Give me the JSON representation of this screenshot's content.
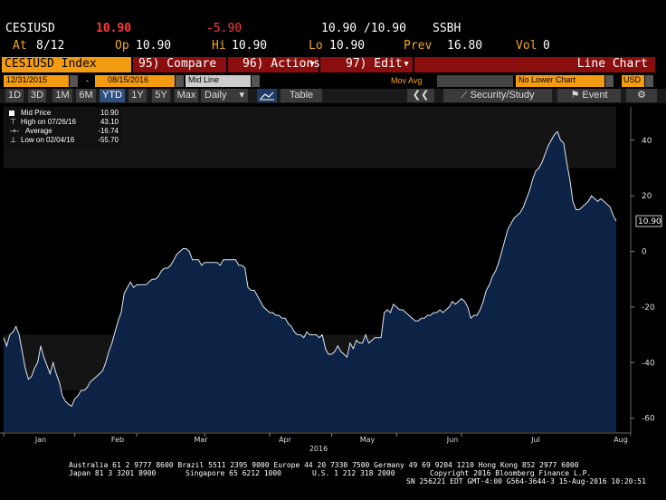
{
  "header": {
    "ticker": "CESIUSD",
    "last": "10.90",
    "change": "-5.90",
    "bidask": "10.90 /10.90",
    "source": "SSBH",
    "at_label": "At",
    "at_value": "8/12",
    "op_label": "Op",
    "op_value": "10.90",
    "hi_label": "Hi",
    "hi_value": "10.90",
    "lo_label": "Lo",
    "lo_value": "10.90",
    "prev_label": "Prev",
    "prev_value": "16.80",
    "vol_label": "Vol",
    "vol_value": "0"
  },
  "menubar": {
    "security_label": "CESIUSD Index",
    "compare": "95) Compare",
    "actions": "96) Actions",
    "edit": "97) Edit",
    "chart_type": "Line Chart"
  },
  "toolbar": {
    "start_date": "12/31/2015",
    "dash": "-",
    "end_date": "08/15/2016",
    "mid_line": "Mid Line",
    "mov_avg": "Mov Avg",
    "lower_chart": "No Lower Chart",
    "currency": "USD"
  },
  "periods": {
    "items": [
      "1D",
      "3D",
      "1M",
      "6M",
      "YTD",
      "1Y",
      "5Y",
      "Max"
    ],
    "selected": "YTD",
    "frequency": "Daily",
    "table": "Table",
    "security_study": "Security/Study",
    "event": "Event"
  },
  "legend": {
    "r1_label": "Mid Price",
    "r1_value": "10.90",
    "r2_label": "High on 07/26/16",
    "r2_value": "43.10",
    "r3_label": "Average",
    "r3_value": "-16.74",
    "r4_label": "Low on 02/04/16",
    "r4_value": "-55.70"
  },
  "chart_data": {
    "type": "area",
    "title": "",
    "xlabel": "2016",
    "ylabel": "",
    "ylim": [
      -65,
      52
    ],
    "yticks": [
      40,
      20,
      0,
      -20,
      -40,
      -60
    ],
    "x_month_labels": [
      "Jan",
      "Feb",
      "Mar",
      "Apr",
      "May",
      "Jun",
      "Jul",
      "Aug"
    ],
    "last_value_label": "10.90",
    "grid": false,
    "series": [
      {
        "values": [
          -31,
          -34,
          -30,
          -29,
          -27,
          -30,
          -36,
          -42,
          -46,
          -45,
          -42,
          -40,
          -34,
          -38,
          -41,
          -44,
          -40,
          -44,
          -47,
          -52,
          -54,
          -55,
          -55.7,
          -53,
          -52,
          -50,
          -50,
          -49,
          -47,
          -46,
          -45,
          -44,
          -43,
          -40,
          -36,
          -33,
          -29,
          -25,
          -22,
          -15,
          -13,
          -11,
          -13,
          -12,
          -12,
          -12,
          -12,
          -11,
          -10,
          -10,
          -9,
          -7,
          -6,
          -6,
          -5,
          -3,
          -1,
          0,
          1,
          1,
          0,
          -3,
          -3,
          -3,
          -5,
          -4,
          -4,
          -4,
          -4,
          -4,
          -5,
          -3,
          -3,
          -3,
          -3,
          -3,
          -5,
          -5,
          -6,
          -13,
          -14,
          -14,
          -16,
          -18,
          -20,
          -21,
          -22,
          -22,
          -23,
          -23,
          -24,
          -24,
          -26,
          -27,
          -29,
          -30,
          -30,
          -31,
          -29,
          -30,
          -30,
          -30,
          -31,
          -30,
          -35,
          -37,
          -37,
          -36,
          -34,
          -36,
          -37,
          -38,
          -33,
          -35,
          -32,
          -33,
          -33,
          -30,
          -33,
          -32,
          -31,
          -31,
          -31,
          -22,
          -21,
          -22,
          -19,
          -20,
          -21,
          -21,
          -22,
          -23,
          -24,
          -25,
          -25,
          -24,
          -24,
          -23,
          -23,
          -22,
          -22,
          -21,
          -22,
          -21,
          -20,
          -18,
          -19,
          -18,
          -17,
          -18,
          -20,
          -24,
          -23,
          -23,
          -21,
          -18,
          -14,
          -12,
          -9,
          -7,
          -4,
          0,
          4,
          8,
          10,
          12,
          13,
          14,
          16,
          19,
          22,
          26,
          29,
          30,
          32,
          35,
          38,
          40,
          42,
          43.1,
          40,
          39,
          32,
          26,
          18,
          15,
          15,
          16,
          17,
          18,
          20,
          19,
          18,
          19,
          18,
          17,
          16,
          13,
          10.9
        ]
      }
    ]
  },
  "footer": {
    "line1": "Australia 61 2 9777 8600 Brazil 5511 2395 9000 Europe 44 20 7330 7500 Germany 49 69 9204 1210 Hong Kong 852 2977 6000",
    "line2_left": "Japan 81 3 3201 8900",
    "line2_mid": "Singapore 65 6212 1000",
    "line2_us": "U.S. 1 212 318 2000",
    "line2_copy": "Copyright 2016 Bloomberg Finance L.P.",
    "line3": "SN 256221 EDT  GMT-4:00 G564-3644-3 15-Aug-2016 10:20:51"
  }
}
